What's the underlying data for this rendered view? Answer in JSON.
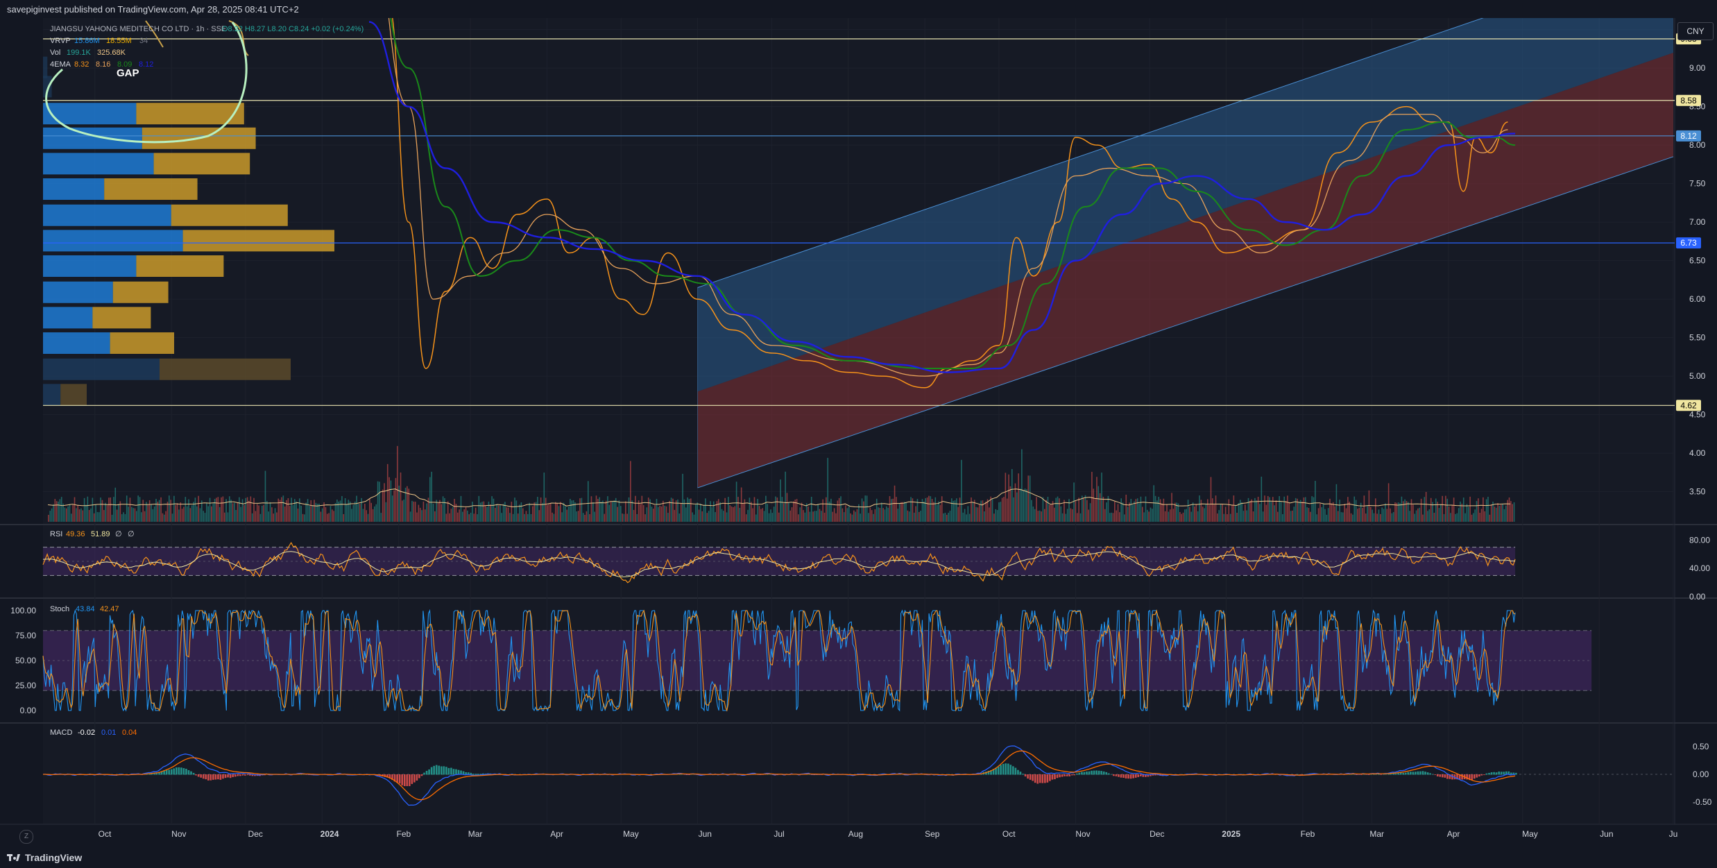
{
  "header": {
    "published": "savepiginvest published on TradingView.com, Apr 28, 2025 08:41 UTC+2"
  },
  "footer": {
    "brand": "TradingView",
    "zoom_label": "Z"
  },
  "currency": "CNY",
  "colors": {
    "bg": "#131722",
    "grid": "#1e222d",
    "text": "#d1d4dc",
    "ema_fast": "#f7931a",
    "ema_mid": "#e8a25a",
    "ema_green": "#1a8a1a",
    "ema_blue": "#1f1fe0",
    "channel_upper": "#2a5b8c",
    "channel_lower": "#7a2e34",
    "vol_up": "#26a69a",
    "vol_down": "#ef5350",
    "rsi_band": "#4a2a6e",
    "rsi_line": "#f7931a",
    "stoch_k": "#2196f3",
    "stoch_d": "#f7931a",
    "vrvp_up": "#1e7bd4",
    "vrvp_down": "#c99a2a",
    "gap_circle": "#b8f0c0"
  },
  "chart_data": [
    {
      "type": "line",
      "title": "JIANGSU YAHONG MEDITECH CO LTD · 1h · SSE",
      "ohlc": {
        "O": "8.22",
        "H": "8.27",
        "L": "8.20",
        "C": "8.24",
        "change": "+0.02 (+0.24%)"
      },
      "legend": {
        "vrvp": {
          "label": "VRVP",
          "v1": "15.86M",
          "v2": "18.55M",
          "v3": "34"
        },
        "vol": {
          "label": "Vol",
          "v1": "199.1K",
          "v2": "325.68K"
        },
        "ema": {
          "label": "4EMA",
          "v1": "8.32",
          "v2": "8.16",
          "v3": "8.09",
          "v4": "8.12"
        }
      },
      "annotation": "GAP",
      "x_ticks": [
        "Oct",
        "Nov",
        "Dec",
        "2024",
        "Feb",
        "Mar",
        "Apr",
        "May",
        "Jun",
        "Jul",
        "Aug",
        "Sep",
        "Oct",
        "Nov",
        "Dec",
        "2025",
        "Feb",
        "Mar",
        "Apr",
        "May",
        "Jun",
        "Ju"
      ],
      "x_range": [
        "2023-09-10",
        "2025-07-01"
      ],
      "y_ticks": [
        9.5,
        9.0,
        8.5,
        8.0,
        7.5,
        7.0,
        6.5,
        6.0,
        5.5,
        5.0,
        4.5,
        4.0,
        3.5
      ],
      "ylim": [
        3.1,
        9.65
      ],
      "price_labels": [
        "9.38",
        "8.58",
        "8.12",
        "6.73",
        "4.62"
      ],
      "horizontal_lines": [
        9.38,
        8.58,
        8.12,
        6.73,
        4.62
      ],
      "series": [
        {
          "name": "EMA fast",
          "x": [
            "2024-01-20",
            "2024-01-28",
            "2024-02-05",
            "2024-02-12",
            "2024-02-20",
            "2024-03-01",
            "2024-03-10",
            "2024-03-20",
            "2024-04-01",
            "2024-04-10",
            "2024-04-20",
            "2024-05-01",
            "2024-05-10",
            "2024-05-20",
            "2024-06-01",
            "2024-06-15",
            "2024-07-01",
            "2024-07-15",
            "2024-08-01",
            "2024-08-15",
            "2024-09-01",
            "2024-09-10",
            "2024-09-20",
            "2024-10-01",
            "2024-10-08",
            "2024-10-15",
            "2024-10-25",
            "2024-11-01",
            "2024-11-10",
            "2024-11-20",
            "2024-12-01",
            "2024-12-10",
            "2024-12-20",
            "2025-01-01",
            "2025-01-15",
            "2025-02-01",
            "2025-02-15",
            "2025-03-01",
            "2025-03-15",
            "2025-03-25",
            "2025-04-01",
            "2025-04-07",
            "2025-04-12",
            "2025-04-18",
            "2025-04-25"
          ],
          "y": [
            11.5,
            9.8,
            7.0,
            5.1,
            6.1,
            6.8,
            6.4,
            7.1,
            7.3,
            6.6,
            6.8,
            6.0,
            5.8,
            6.6,
            6.0,
            5.6,
            5.3,
            5.2,
            5.05,
            5.0,
            4.85,
            5.1,
            5.2,
            5.4,
            6.8,
            6.3,
            7.0,
            8.1,
            8.0,
            7.7,
            7.75,
            7.3,
            7.0,
            6.6,
            6.7,
            6.9,
            7.9,
            8.3,
            8.5,
            8.3,
            8.3,
            7.4,
            8.1,
            7.9,
            8.3
          ]
        },
        {
          "name": "EMA mid",
          "x": [
            "2024-01-20",
            "2024-02-05",
            "2024-02-15",
            "2024-03-01",
            "2024-03-15",
            "2024-04-01",
            "2024-04-15",
            "2024-05-01",
            "2024-05-15",
            "2024-06-01",
            "2024-06-15",
            "2024-07-01",
            "2024-08-01",
            "2024-09-01",
            "2024-09-20",
            "2024-10-01",
            "2024-10-15",
            "2024-11-01",
            "2024-11-15",
            "2024-12-01",
            "2024-12-15",
            "2025-01-01",
            "2025-01-15",
            "2025-02-01",
            "2025-02-20",
            "2025-03-10",
            "2025-03-25",
            "2025-04-05",
            "2025-04-15",
            "2025-04-25"
          ],
          "y": [
            10.8,
            8.5,
            6.0,
            6.3,
            6.6,
            7.1,
            6.9,
            6.4,
            6.2,
            6.3,
            5.8,
            5.4,
            5.2,
            5.0,
            5.15,
            5.3,
            6.4,
            7.6,
            7.7,
            7.6,
            7.5,
            6.9,
            6.6,
            6.9,
            7.8,
            8.4,
            8.4,
            8.1,
            7.9,
            8.2
          ]
        },
        {
          "name": "EMA green",
          "x": [
            "2024-01-20",
            "2024-02-05",
            "2024-02-20",
            "2024-03-05",
            "2024-03-20",
            "2024-04-05",
            "2024-04-20",
            "2024-05-05",
            "2024-05-20",
            "2024-06-05",
            "2024-06-20",
            "2024-07-10",
            "2024-08-01",
            "2024-09-01",
            "2024-09-20",
            "2024-10-05",
            "2024-10-20",
            "2024-11-05",
            "2024-11-20",
            "2024-12-05",
            "2024-12-20",
            "2025-01-10",
            "2025-01-25",
            "2025-02-10",
            "2025-02-25",
            "2025-03-15",
            "2025-03-30",
            "2025-04-10",
            "2025-04-20",
            "2025-04-28"
          ],
          "y": [
            10.6,
            9.0,
            7.2,
            6.3,
            6.5,
            6.9,
            6.8,
            6.5,
            6.3,
            6.2,
            5.8,
            5.4,
            5.2,
            5.1,
            5.1,
            5.4,
            6.2,
            7.2,
            7.7,
            7.7,
            7.4,
            6.9,
            6.7,
            6.9,
            7.6,
            8.2,
            8.3,
            8.1,
            8.1,
            8.0
          ]
        },
        {
          "name": "EMA blue",
          "x": [
            "2024-01-20",
            "2024-02-05",
            "2024-02-20",
            "2024-03-10",
            "2024-04-01",
            "2024-04-20",
            "2024-05-10",
            "2024-06-01",
            "2024-06-20",
            "2024-07-10",
            "2024-08-01",
            "2024-08-20",
            "2024-09-10",
            "2024-10-01",
            "2024-10-15",
            "2024-11-01",
            "2024-11-20",
            "2024-12-05",
            "2024-12-20",
            "2025-01-10",
            "2025-01-25",
            "2025-02-10",
            "2025-02-25",
            "2025-03-15",
            "2025-04-01",
            "2025-04-15",
            "2025-04-28"
          ],
          "y": [
            9.6,
            8.5,
            7.7,
            7.0,
            6.8,
            6.65,
            6.5,
            6.3,
            5.8,
            5.45,
            5.25,
            5.15,
            5.05,
            5.1,
            5.6,
            6.5,
            7.1,
            7.5,
            7.6,
            7.3,
            7.0,
            6.9,
            7.1,
            7.6,
            8.0,
            8.1,
            8.15
          ]
        }
      ],
      "channel": {
        "start": "2024-06-01",
        "end": "2025-07-01",
        "upper_start": 6.15,
        "upper_end": 10.5,
        "mid_start": 4.8,
        "mid_end": 9.2,
        "lower_start": 3.55,
        "lower_end": 7.85
      },
      "vrvp_levels": [
        {
          "price": 9.0,
          "up": 0.015,
          "down": 0.0
        },
        {
          "price": 8.75,
          "up": 0.03,
          "down": 0.0
        },
        {
          "price": 8.4,
          "up": 0.32,
          "down": 0.37
        },
        {
          "price": 8.08,
          "up": 0.34,
          "down": 0.39
        },
        {
          "price": 7.75,
          "up": 0.38,
          "down": 0.33
        },
        {
          "price": 7.42,
          "up": 0.21,
          "down": 0.32
        },
        {
          "price": 7.08,
          "up": 0.44,
          "down": 0.4
        },
        {
          "price": 6.75,
          "up": 0.48,
          "down": 0.52
        },
        {
          "price": 6.42,
          "up": 0.32,
          "down": 0.3
        },
        {
          "price": 6.08,
          "up": 0.24,
          "down": 0.19
        },
        {
          "price": 5.75,
          "up": 0.17,
          "down": 0.2
        },
        {
          "price": 5.42,
          "up": 0.23,
          "down": 0.22
        },
        {
          "price": 5.08,
          "up": 0.4,
          "down": 0.45
        },
        {
          "price": 4.75,
          "up": 0.06,
          "down": 0.09
        }
      ]
    },
    {
      "type": "line",
      "title": "RSI",
      "legend": {
        "v1": "49.36",
        "v2": "51.89",
        "v3": "∅",
        "v4": "∅"
      },
      "y_ticks": [
        80.0,
        40.0,
        0.0
      ],
      "ylim": [
        0,
        100
      ],
      "bands": [
        70,
        30
      ],
      "last_value": 49.36
    },
    {
      "type": "line",
      "title": "Stoch",
      "legend": {
        "k": "43.84",
        "d": "42.47"
      },
      "y_ticks": [
        100.0,
        75.0,
        50.0,
        25.0,
        0.0
      ],
      "ylim": [
        0,
        100
      ],
      "bands": [
        80,
        20
      ]
    },
    {
      "type": "bar",
      "title": "MACD",
      "legend": {
        "hist": "-0.02",
        "macd": "0.01",
        "signal": "0.04"
      },
      "y_ticks": [
        0.5,
        0.0,
        -0.5
      ],
      "ylim": [
        -0.75,
        0.75
      ]
    }
  ]
}
